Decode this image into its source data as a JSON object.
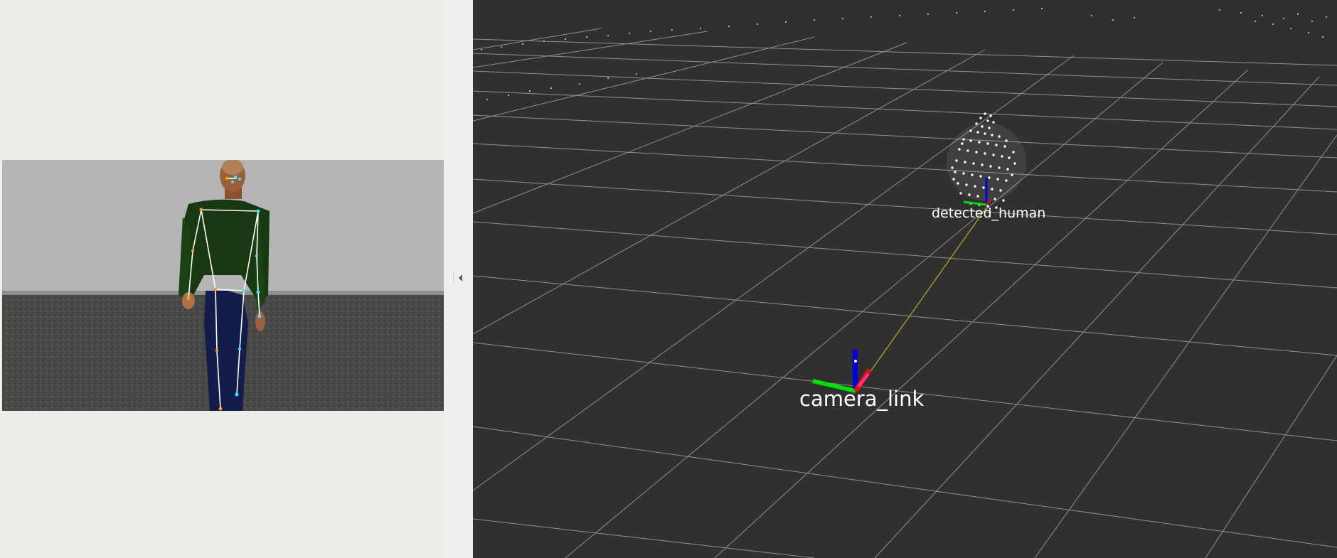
{
  "viewport": {
    "frames": [
      {
        "id": "human",
        "label": "detected_human"
      },
      {
        "id": "camera",
        "label": "camera_link"
      }
    ]
  },
  "colors": {
    "background_3d": "#303030",
    "grid": "#a0a0a0",
    "x_axis": "#e01010",
    "y_axis": "#00e000",
    "z_axis": "#0000e0",
    "tf_link": "#a8a020",
    "point_cloud": "#ffffff",
    "panel_bg": "#efede9"
  },
  "image_view": {
    "keypoint_colors": [
      "#ffffff",
      "#40e0ff",
      "#f0a020"
    ]
  },
  "icons": {
    "collapse": "triangle-left-icon"
  }
}
